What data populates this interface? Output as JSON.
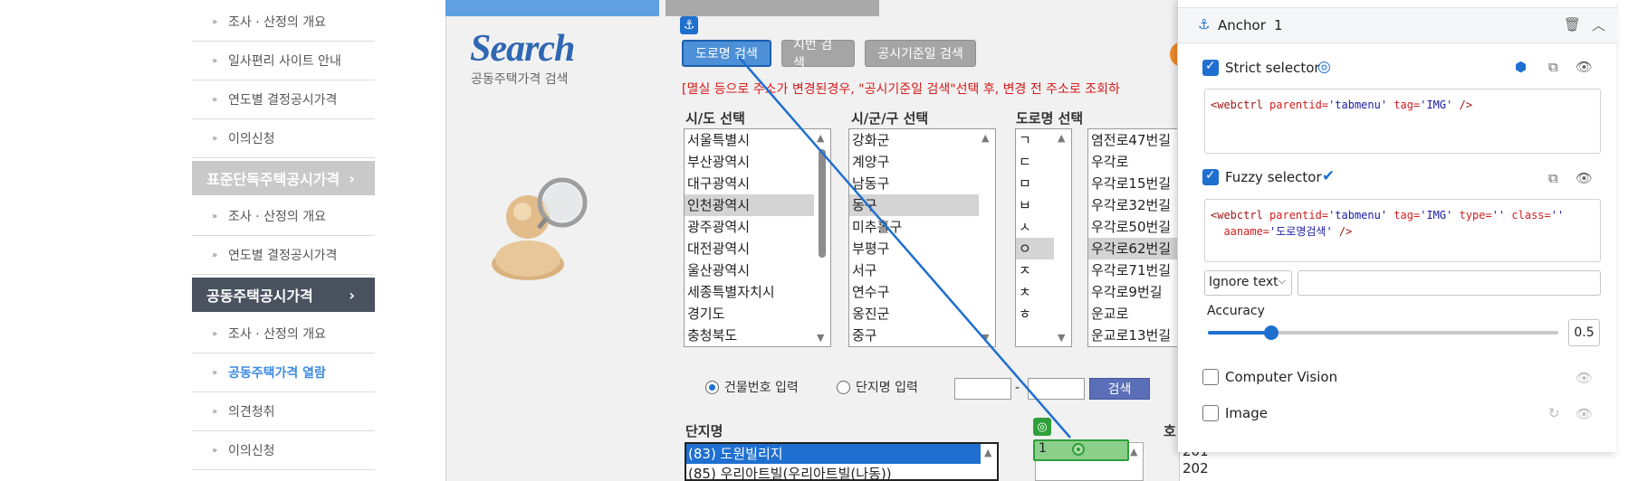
{
  "sidebar": {
    "items_top": [
      {
        "label": "조사 · 산정의 개요"
      },
      {
        "label": "일사편리 사이트 안내"
      },
      {
        "label": "연도별 결정공시가격"
      },
      {
        "label": "이의신청"
      }
    ],
    "cat_standard": {
      "label": "표준단독주택공시가격",
      "arrow": "›"
    },
    "items_mid": [
      {
        "label": "조사 · 산정의 개요"
      },
      {
        "label": "연도별 결정공시가격"
      }
    ],
    "cat_apartment": {
      "label": "공동주택공시가격",
      "arrow": "›"
    },
    "items_bottom": [
      {
        "label": "조사 · 산정의 개요"
      },
      {
        "label": "공동주택가격 열람"
      },
      {
        "label": "의견청취"
      },
      {
        "label": "이의신청"
      }
    ],
    "bullet": "»"
  },
  "search": {
    "title": "Search",
    "subtitle": "공동주택가격 검색",
    "tabs": [
      "도로명 검색",
      "지번 검색",
      "공시기준일 검색"
    ],
    "notice": "[멸실 등으로 주소가 변경된경우, \"공시기준일 검색\"선택 후, 변경 전 주소로 조회하",
    "sido_header": "시/도 선택",
    "sido": [
      "서울특별시",
      "부산광역시",
      "대구광역시",
      "인천광역시",
      "광주광역시",
      "대전광역시",
      "울산광역시",
      "세종특별자치시",
      "경기도",
      "충청북도"
    ],
    "sigungu_header": "시/군/구 선택",
    "sigungu": [
      "강화군",
      "계양구",
      "남동구",
      "동구",
      "미추홀구",
      "부평구",
      "서구",
      "연수구",
      "옹진군",
      "중구"
    ],
    "road_header": "도로명 선택",
    "initials": [
      "ㄱ",
      "ㄷ",
      "ㅁ",
      "ㅂ",
      "ㅅ",
      "ㅇ",
      "ㅈ",
      "ㅊ",
      "ㅎ"
    ],
    "roads": [
      "염전로47번길",
      "우각로",
      "우각로15번길",
      "우각로32번길",
      "우각로50번길",
      "우각로62번길",
      "우각로71번길",
      "우각로9번길",
      "운교로",
      "운교로13번길"
    ],
    "radio_building": "건물번호 입력",
    "radio_complex": "단지명 입력",
    "dash": "-",
    "search_button": "검색",
    "complex_header": "단지명",
    "complexes": [
      "(83) 도원빌리지",
      "(85) 우리아트빌(우리아트빌(나동))"
    ],
    "dong_value": "1",
    "ho_header": "호",
    "ho_values": [
      "201",
      "202"
    ]
  },
  "inspector": {
    "title": "Anchor",
    "count": "1",
    "strict_label": "Strict selector",
    "strict_code": {
      "tag": "<webctrl",
      "a1": "parentid=",
      "v1": "'tabmenu'",
      "a2": "tag=",
      "v2": "'IMG'",
      "end": "/>"
    },
    "fuzzy_label": "Fuzzy selector",
    "fuzzy_code": {
      "tag": "<webctrl",
      "a1": "parentid=",
      "v1": "'tabmenu'",
      "a2": "tag=",
      "v2": "'IMG'",
      "a3": "type=",
      "v3": "''",
      "a4": "class=",
      "v4": "''",
      "a5": "aaname=",
      "v5": "'도로명검색'",
      "end": "/>"
    },
    "ignore_select": "Ignore text",
    "accuracy_label": "Accuracy",
    "accuracy_value": "0.5",
    "accuracy_fraction": 0.18,
    "cv_label": "Computer Vision",
    "image_label": "Image"
  }
}
